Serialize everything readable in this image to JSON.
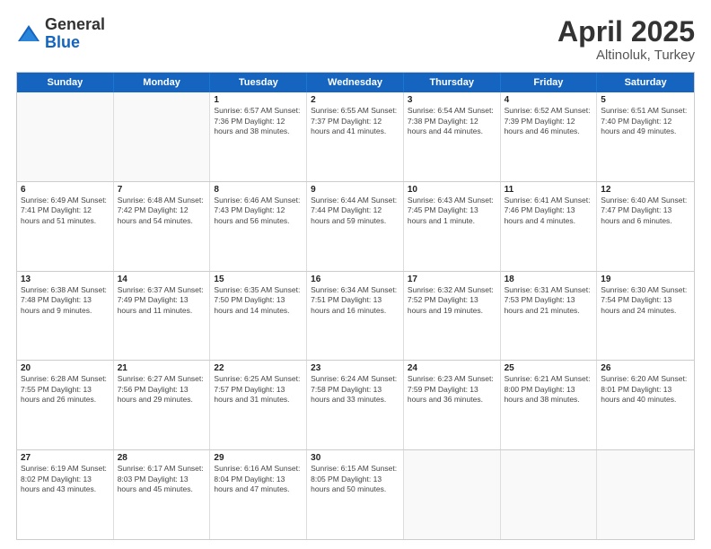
{
  "header": {
    "logo_general": "General",
    "logo_blue": "Blue",
    "title": "April 2025",
    "location": "Altinoluk, Turkey"
  },
  "days_of_week": [
    "Sunday",
    "Monday",
    "Tuesday",
    "Wednesday",
    "Thursday",
    "Friday",
    "Saturday"
  ],
  "rows": [
    [
      {
        "num": "",
        "info": "",
        "empty": true
      },
      {
        "num": "",
        "info": "",
        "empty": true
      },
      {
        "num": "1",
        "info": "Sunrise: 6:57 AM\nSunset: 7:36 PM\nDaylight: 12 hours and 38 minutes."
      },
      {
        "num": "2",
        "info": "Sunrise: 6:55 AM\nSunset: 7:37 PM\nDaylight: 12 hours and 41 minutes."
      },
      {
        "num": "3",
        "info": "Sunrise: 6:54 AM\nSunset: 7:38 PM\nDaylight: 12 hours and 44 minutes."
      },
      {
        "num": "4",
        "info": "Sunrise: 6:52 AM\nSunset: 7:39 PM\nDaylight: 12 hours and 46 minutes."
      },
      {
        "num": "5",
        "info": "Sunrise: 6:51 AM\nSunset: 7:40 PM\nDaylight: 12 hours and 49 minutes."
      }
    ],
    [
      {
        "num": "6",
        "info": "Sunrise: 6:49 AM\nSunset: 7:41 PM\nDaylight: 12 hours and 51 minutes."
      },
      {
        "num": "7",
        "info": "Sunrise: 6:48 AM\nSunset: 7:42 PM\nDaylight: 12 hours and 54 minutes."
      },
      {
        "num": "8",
        "info": "Sunrise: 6:46 AM\nSunset: 7:43 PM\nDaylight: 12 hours and 56 minutes."
      },
      {
        "num": "9",
        "info": "Sunrise: 6:44 AM\nSunset: 7:44 PM\nDaylight: 12 hours and 59 minutes."
      },
      {
        "num": "10",
        "info": "Sunrise: 6:43 AM\nSunset: 7:45 PM\nDaylight: 13 hours and 1 minute."
      },
      {
        "num": "11",
        "info": "Sunrise: 6:41 AM\nSunset: 7:46 PM\nDaylight: 13 hours and 4 minutes."
      },
      {
        "num": "12",
        "info": "Sunrise: 6:40 AM\nSunset: 7:47 PM\nDaylight: 13 hours and 6 minutes."
      }
    ],
    [
      {
        "num": "13",
        "info": "Sunrise: 6:38 AM\nSunset: 7:48 PM\nDaylight: 13 hours and 9 minutes."
      },
      {
        "num": "14",
        "info": "Sunrise: 6:37 AM\nSunset: 7:49 PM\nDaylight: 13 hours and 11 minutes."
      },
      {
        "num": "15",
        "info": "Sunrise: 6:35 AM\nSunset: 7:50 PM\nDaylight: 13 hours and 14 minutes."
      },
      {
        "num": "16",
        "info": "Sunrise: 6:34 AM\nSunset: 7:51 PM\nDaylight: 13 hours and 16 minutes."
      },
      {
        "num": "17",
        "info": "Sunrise: 6:32 AM\nSunset: 7:52 PM\nDaylight: 13 hours and 19 minutes."
      },
      {
        "num": "18",
        "info": "Sunrise: 6:31 AM\nSunset: 7:53 PM\nDaylight: 13 hours and 21 minutes."
      },
      {
        "num": "19",
        "info": "Sunrise: 6:30 AM\nSunset: 7:54 PM\nDaylight: 13 hours and 24 minutes."
      }
    ],
    [
      {
        "num": "20",
        "info": "Sunrise: 6:28 AM\nSunset: 7:55 PM\nDaylight: 13 hours and 26 minutes."
      },
      {
        "num": "21",
        "info": "Sunrise: 6:27 AM\nSunset: 7:56 PM\nDaylight: 13 hours and 29 minutes."
      },
      {
        "num": "22",
        "info": "Sunrise: 6:25 AM\nSunset: 7:57 PM\nDaylight: 13 hours and 31 minutes."
      },
      {
        "num": "23",
        "info": "Sunrise: 6:24 AM\nSunset: 7:58 PM\nDaylight: 13 hours and 33 minutes."
      },
      {
        "num": "24",
        "info": "Sunrise: 6:23 AM\nSunset: 7:59 PM\nDaylight: 13 hours and 36 minutes."
      },
      {
        "num": "25",
        "info": "Sunrise: 6:21 AM\nSunset: 8:00 PM\nDaylight: 13 hours and 38 minutes."
      },
      {
        "num": "26",
        "info": "Sunrise: 6:20 AM\nSunset: 8:01 PM\nDaylight: 13 hours and 40 minutes."
      }
    ],
    [
      {
        "num": "27",
        "info": "Sunrise: 6:19 AM\nSunset: 8:02 PM\nDaylight: 13 hours and 43 minutes."
      },
      {
        "num": "28",
        "info": "Sunrise: 6:17 AM\nSunset: 8:03 PM\nDaylight: 13 hours and 45 minutes."
      },
      {
        "num": "29",
        "info": "Sunrise: 6:16 AM\nSunset: 8:04 PM\nDaylight: 13 hours and 47 minutes."
      },
      {
        "num": "30",
        "info": "Sunrise: 6:15 AM\nSunset: 8:05 PM\nDaylight: 13 hours and 50 minutes."
      },
      {
        "num": "",
        "info": "",
        "empty": true
      },
      {
        "num": "",
        "info": "",
        "empty": true
      },
      {
        "num": "",
        "info": "",
        "empty": true
      }
    ]
  ]
}
